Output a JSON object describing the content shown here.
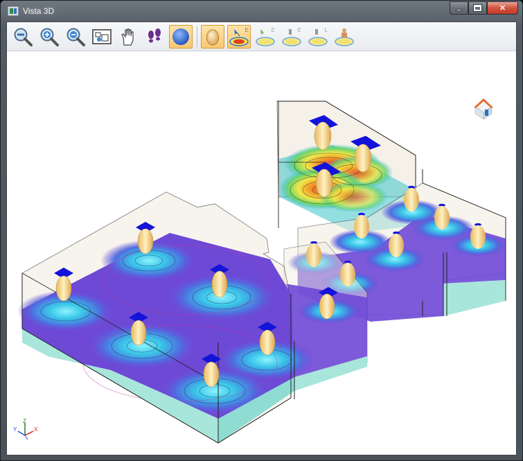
{
  "window": {
    "title": "Vista 3D",
    "min_glyph": "",
    "max_glyph": "",
    "close_glyph": "✕"
  },
  "toolbar": {
    "buttons": [
      {
        "name": "zoom-window-icon",
        "active": false
      },
      {
        "name": "zoom-in-icon",
        "active": false
      },
      {
        "name": "zoom-out-icon",
        "active": false
      },
      {
        "name": "zoom-extents-icon",
        "active": false
      },
      {
        "name": "pan-hand-icon",
        "active": false
      },
      {
        "name": "walk-footprints-icon",
        "active": false
      },
      {
        "name": "sphere-render-icon",
        "active": true
      },
      {
        "name": "luminaire-solid-icon",
        "active": true
      },
      {
        "name": "isolines-e-icon",
        "active": true,
        "label": "E"
      },
      {
        "name": "isolines-e-alt-icon",
        "active": false,
        "label": "E"
      },
      {
        "name": "isolines-e-lamp-icon",
        "active": false,
        "label": "E"
      },
      {
        "name": "isolines-l-icon",
        "active": false,
        "label": "L"
      },
      {
        "name": "isolines-person-icon",
        "active": false
      }
    ]
  },
  "viewport": {
    "axis_labels": {
      "x": "X",
      "y": "Y",
      "z": "Z"
    },
    "colors": {
      "wall_fill": "#f1ece0",
      "floor_edge": "#a8e6dc",
      "plane_deep": "#5a3ec8",
      "plane_mid": "#6e49d6",
      "hot_red": "#e8492c",
      "luminaire": "#f6d98a",
      "fixture_blue": "#1313d9"
    }
  }
}
